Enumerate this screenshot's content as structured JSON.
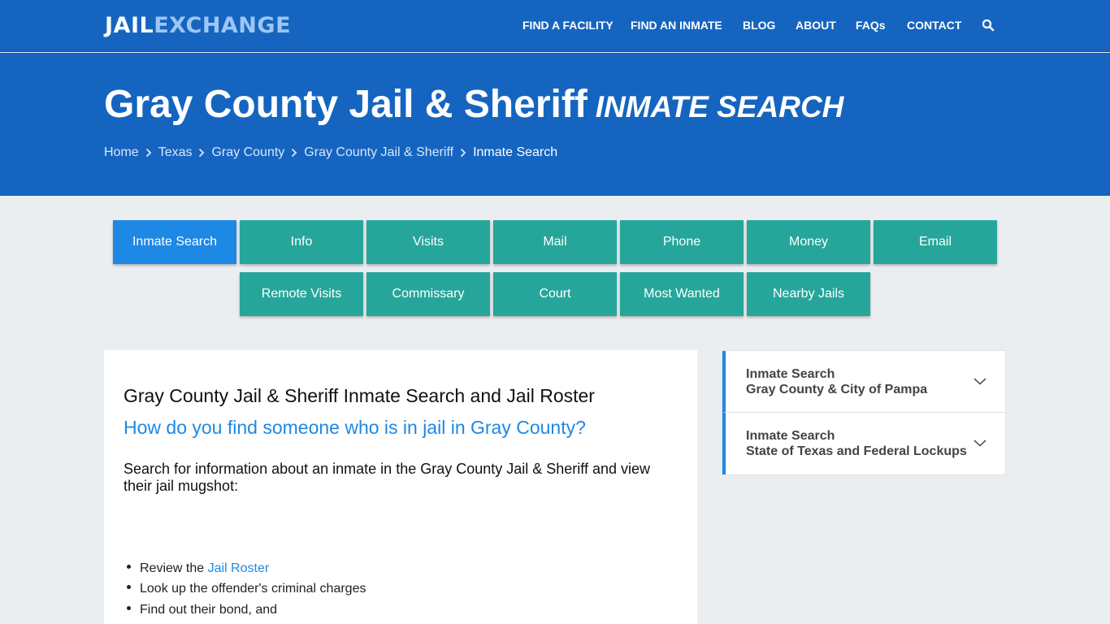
{
  "logo": {
    "part1": "JAIL",
    "part2": "EXCHANGE"
  },
  "nav": [
    "FIND A FACILITY",
    "FIND AN INMATE",
    "BLOG",
    "ABOUT",
    "FAQs",
    "CONTACT"
  ],
  "hero": {
    "title": "Gray County Jail & Sheriff",
    "subtitle": "INMATE SEARCH",
    "breadcrumbs": [
      "Home",
      "Texas",
      "Gray County",
      "Gray County Jail & Sheriff",
      "Inmate Search"
    ]
  },
  "tabs_row1": [
    "Inmate Search",
    "Info",
    "Visits",
    "Mail",
    "Phone",
    "Money",
    "Email"
  ],
  "tabs_row2": [
    "Remote Visits",
    "Commissary",
    "Court",
    "Most Wanted",
    "Nearby Jails"
  ],
  "content": {
    "heading": "Gray County Jail & Sheriff Inmate Search and Jail Roster",
    "question": "How do you find someone who is in jail in Gray County?",
    "lead": "Search for information about an inmate in the Gray County Jail & Sheriff and view their jail mugshot:",
    "bullet1_prefix": "Review the ",
    "bullet1_link": "Jail Roster",
    "bullet2": "Look up the offender's criminal charges",
    "bullet3": "Find out their bond, and"
  },
  "sidebar": [
    {
      "line1": "Inmate Search",
      "line2": "Gray County & City of Pampa"
    },
    {
      "line1": "Inmate Search",
      "line2": "State of Texas and Federal Lockups"
    }
  ],
  "colors": {
    "header": "#1565c0",
    "tab": "#26a69a",
    "tab_active": "#1e88e5",
    "link": "#1e88e5"
  }
}
